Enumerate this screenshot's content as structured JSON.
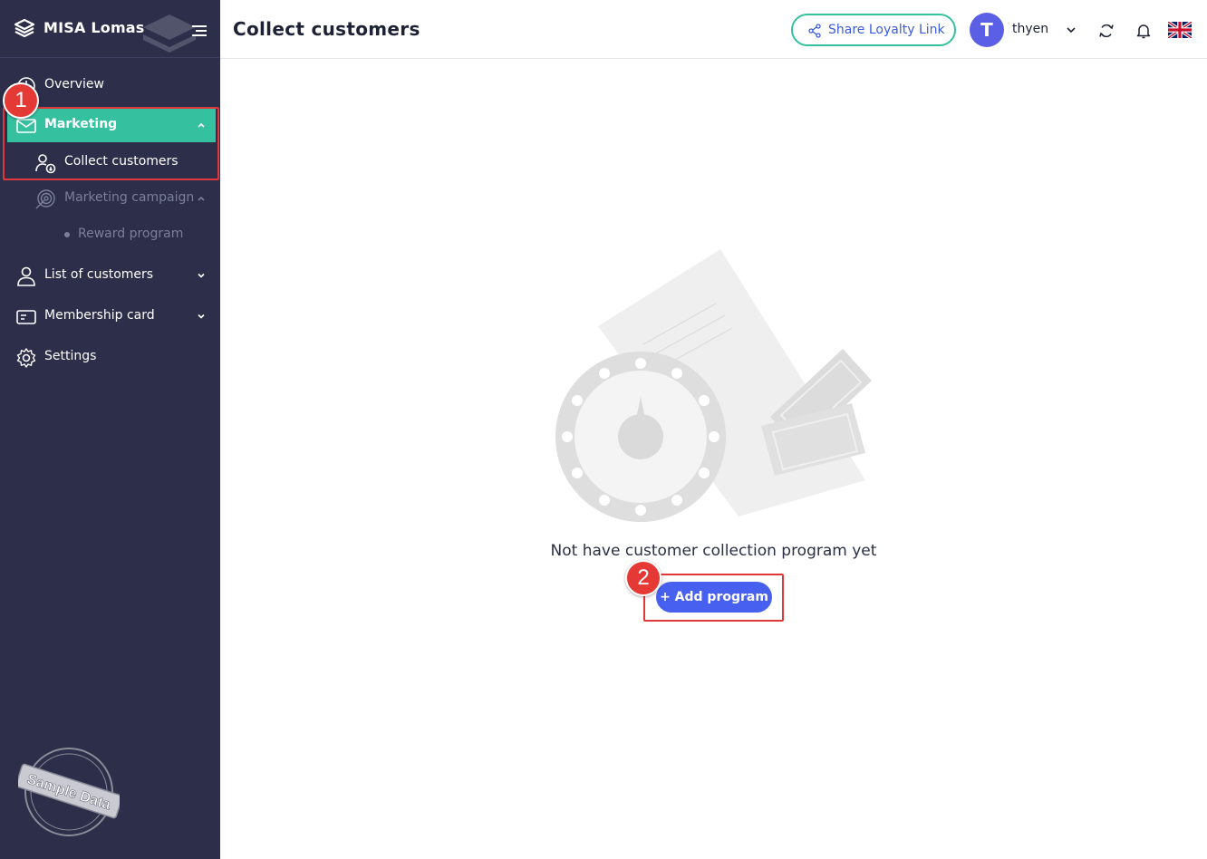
{
  "brand": {
    "name": "MISA Lomas"
  },
  "sidebar": {
    "items": [
      {
        "label": "Overview"
      },
      {
        "label": "Marketing"
      },
      {
        "label": "Collect customers"
      },
      {
        "label": "Marketing campaign"
      },
      {
        "label": "Reward program"
      },
      {
        "label": "List of customers"
      },
      {
        "label": "Membership card"
      },
      {
        "label": "Settings"
      }
    ],
    "stamp_text": "Sample Data"
  },
  "header": {
    "title": "Collect customers",
    "share_label": "Share Loyalty Link",
    "avatar_initial": "T",
    "username": "thyen"
  },
  "main": {
    "empty_message": "Not have customer collection program yet",
    "add_button_label": "+ Add program"
  },
  "annotations": {
    "step1": "1",
    "step2": "2"
  },
  "colors": {
    "sidebar_bg": "#2c2e4a",
    "active_item": "#35c1a0",
    "primary_button": "#4760f0",
    "avatar": "#5b5fe6",
    "annotation": "#e53935"
  }
}
